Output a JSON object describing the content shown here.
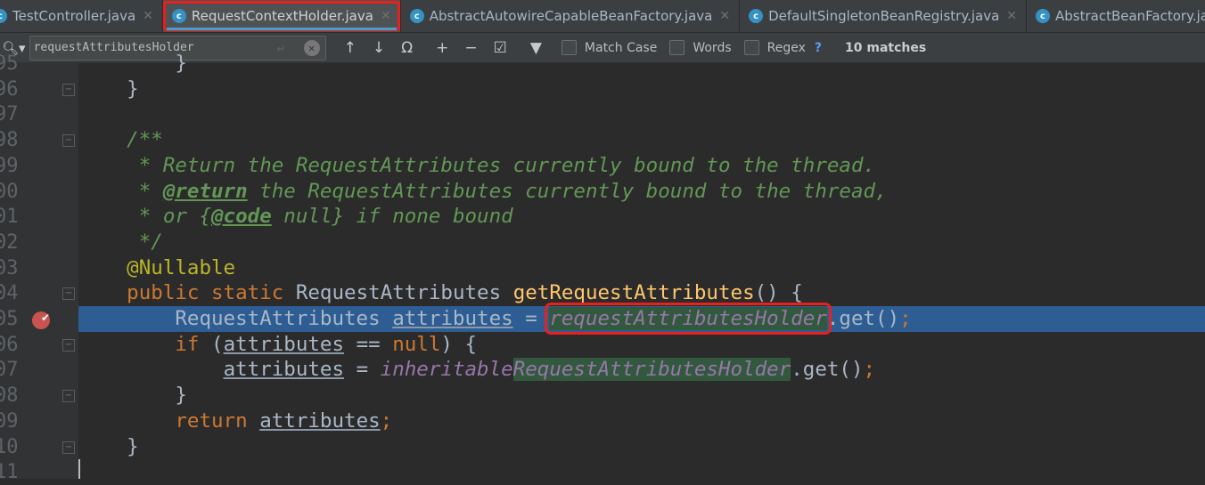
{
  "tabs": [
    {
      "label": "TestController.java",
      "active": false
    },
    {
      "label": "RequestContextHolder.java",
      "active": true
    },
    {
      "label": "AbstractAutowireCapableBeanFactory.java",
      "active": false
    },
    {
      "label": "DefaultSingletonBeanRegistry.java",
      "active": false
    },
    {
      "label": "AbstractBeanFactory.java",
      "active": false
    }
  ],
  "find": {
    "query": "requestAttributesHolder",
    "match_case": "Match Case",
    "words": "Words",
    "regex": "Regex",
    "help": "?",
    "matches": "10 matches",
    "match_case_checked": false,
    "words_checked": false,
    "regex_checked": false
  },
  "colors": {
    "accent": "#4a9ccb",
    "selection": "#2d5d93",
    "match_highlight": "#32593d",
    "annotation_box": "#e8201e"
  },
  "line_numbers": [
    "95",
    "96",
    "97",
    "98",
    "99",
    "00",
    "01",
    "02",
    "03",
    "04",
    "05",
    "06",
    "07",
    "08",
    "09",
    "10",
    "11"
  ],
  "breakpoint_line": "05",
  "lines": [
    [
      {
        "t": "        }",
        "c": ""
      }
    ],
    [
      {
        "t": "    }",
        "c": ""
      }
    ],
    [],
    [
      {
        "t": "    /**",
        "c": "cm"
      }
    ],
    [
      {
        "t": "     * Return the RequestAttributes currently bound to the thread.",
        "c": "cm"
      }
    ],
    [
      {
        "t": "     * ",
        "c": "cm"
      },
      {
        "t": "@return",
        "c": "cmt"
      },
      {
        "t": " the RequestAttributes currently bound to the thread,",
        "c": "cm"
      }
    ],
    [
      {
        "t": "     * or {",
        "c": "cm"
      },
      {
        "t": "@code",
        "c": "cmt"
      },
      {
        "t": " null} if none bound",
        "c": "cm"
      }
    ],
    [
      {
        "t": "     */",
        "c": "cm"
      }
    ],
    [
      {
        "t": "    @Nullable",
        "c": "an"
      }
    ],
    [
      {
        "t": "    public static ",
        "c": "kw"
      },
      {
        "t": "RequestAttributes ",
        "c": ""
      },
      {
        "t": "getRequestAttributes",
        "c": "me"
      },
      {
        "t": "() {",
        "c": ""
      }
    ],
    [
      {
        "t": "        RequestAttributes ",
        "c": ""
      },
      {
        "t": "attributes",
        "c": "va"
      },
      {
        "t": " = ",
        "c": ""
      },
      {
        "t": "requestAttributesHolder",
        "c": "fi hl hlred"
      },
      {
        "t": ".get()",
        "c": ""
      },
      {
        "t": ";",
        "c": "kw"
      }
    ],
    [
      {
        "t": "        if ",
        "c": "kw"
      },
      {
        "t": "(",
        "c": ""
      },
      {
        "t": "attributes",
        "c": "va"
      },
      {
        "t": " == ",
        "c": ""
      },
      {
        "t": "null",
        "c": "kw"
      },
      {
        "t": ") {",
        "c": ""
      }
    ],
    [
      {
        "t": "            ",
        "c": ""
      },
      {
        "t": "attributes",
        "c": "va"
      },
      {
        "t": " = ",
        "c": ""
      },
      {
        "t": "inheritable",
        "c": "fi"
      },
      {
        "t": "RequestAttributesHolder",
        "c": "fi hl"
      },
      {
        "t": ".get()",
        "c": ""
      },
      {
        "t": ";",
        "c": "kw"
      }
    ],
    [
      {
        "t": "        }",
        "c": ""
      }
    ],
    [
      {
        "t": "        return ",
        "c": "kw"
      },
      {
        "t": "attributes",
        "c": "va"
      },
      {
        "t": ";",
        "c": "kw"
      }
    ],
    [
      {
        "t": "    }",
        "c": ""
      }
    ],
    []
  ]
}
